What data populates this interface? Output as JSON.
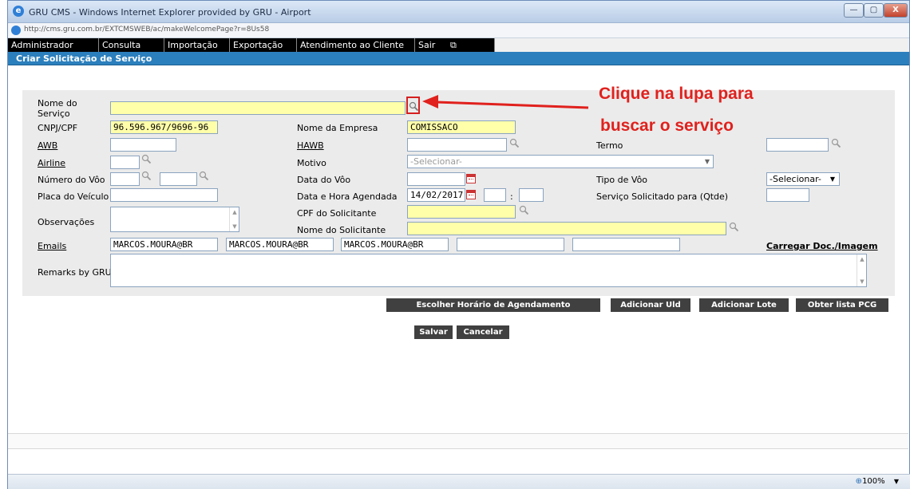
{
  "window": {
    "title": "GRU CMS - Windows Internet Explorer provided by GRU - Airport",
    "url": "http://cms.gru.com.br/EXTCMSWEB/ac/makeWelcomePage?r=8Us58",
    "buttons": {
      "close": "X"
    }
  },
  "menu": [
    "Administrador",
    "Consulta",
    "Importação",
    "Exportação",
    "Atendimento ao Cliente",
    "Sair"
  ],
  "page_title": "Criar Solicitação de Serviço",
  "callout": {
    "line1": "Clique  na  lupa  para",
    "line2": "buscar o serviço",
    "color": "#e0211d"
  },
  "form": {
    "nome_servico": {
      "label_1": "Nome do",
      "label_2": "Serviço",
      "value": ""
    },
    "cnpj": {
      "label": "CNPJ/CPF",
      "value": "96.596.967/9696-96"
    },
    "nome_empresa": {
      "label": "Nome da Empresa",
      "value": "COMISSACO"
    },
    "awb": {
      "label": "AWB",
      "value": ""
    },
    "hawb": {
      "label": "HAWB",
      "value": ""
    },
    "termo": {
      "label": "Termo",
      "value": ""
    },
    "airline": {
      "label": "Airline",
      "value": ""
    },
    "motivo": {
      "label": "Motivo",
      "value": "-Selecionar-"
    },
    "numero_voo": {
      "label": "Número do Vôo"
    },
    "data_voo": {
      "label": "Data do Vôo",
      "value": ""
    },
    "tipo_voo": {
      "label": "Tipo de Vôo",
      "value": "-Selecionar-"
    },
    "placa": {
      "label": "Placa do Veículo",
      "value": ""
    },
    "data_hora": {
      "label": "Data e Hora Agendada",
      "date": "14/02/2017",
      "sep": ":"
    },
    "servico_qtde": {
      "label": "Serviço Solicitado para (Qtde)",
      "value": ""
    },
    "observacoes": {
      "label": "Observações"
    },
    "cpf_solicitante": {
      "label": "CPF do Solicitante",
      "value": ""
    },
    "nome_solicitante": {
      "label": "Nome do Solicitante",
      "value": ""
    },
    "emails": {
      "label": "Emails",
      "values": [
        "MARCOS.MOURA@BR",
        "MARCOS.MOURA@BR",
        "MARCOS.MOURA@BR",
        "",
        ""
      ]
    },
    "carregar": "Carregar Doc./Imagem",
    "remarks": {
      "label": "Remarks by GRU"
    }
  },
  "actions": {
    "escolher": "Escolher Horário de Agendamento",
    "adicionar_uld": "Adicionar Uld",
    "adicionar_lote": "Adicionar Lote",
    "obter_pcg": "Obter lista PCG",
    "salvar": "Salvar",
    "cancelar": "Cancelar"
  },
  "status": {
    "zoom": "100%"
  }
}
